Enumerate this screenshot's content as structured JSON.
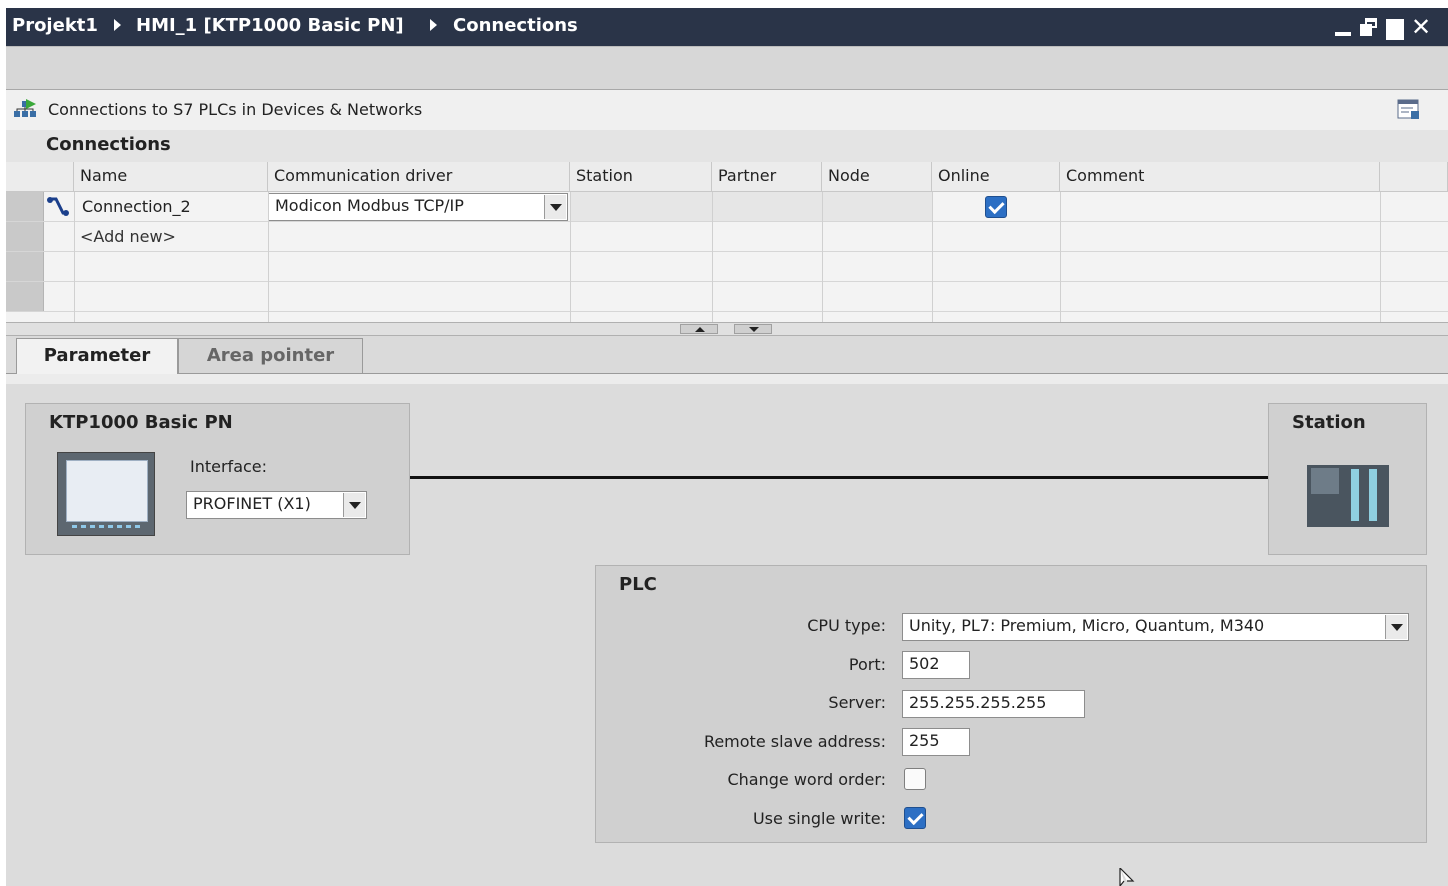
{
  "title_bar": {
    "breadcrumb": [
      "Projekt1",
      "HMI_1 [KTP1000 Basic PN]",
      "Connections"
    ]
  },
  "info_bar": {
    "text": "Connections to S7 PLCs in Devices & Networks"
  },
  "connections": {
    "heading": "Connections",
    "columns": [
      "Name",
      "Communication driver",
      "Station",
      "Partner",
      "Node",
      "Online",
      "Comment"
    ],
    "rows": [
      {
        "name": "Connection_2",
        "driver": "Modicon Modbus TCP/IP",
        "online": true
      }
    ],
    "add_new": "<Add new>"
  },
  "tabs": [
    "Parameter",
    "Area pointer"
  ],
  "device": {
    "title": "KTP1000 Basic PN",
    "interface_label": "Interface:",
    "interface_value": "PROFINET (X1)"
  },
  "station": {
    "title": "Station"
  },
  "plc": {
    "title": "PLC",
    "cpu_type_label": "CPU type:",
    "cpu_type_value": "Unity, PL7: Premium, Micro, Quantum, M340",
    "port_label": "Port:",
    "port_value": "502",
    "server_label": "Server:",
    "server_value": "255.255.255.255",
    "remote_slave_label": "Remote slave address:",
    "remote_slave_value": "255",
    "change_word_order_label": "Change word order:",
    "change_word_order": false,
    "use_single_write_label": "Use single write:",
    "use_single_write": true
  },
  "colors": {
    "title_bar": "#2a3448",
    "checkbox_checked": "#2c6fc4",
    "panel": "#dcdcdc"
  }
}
